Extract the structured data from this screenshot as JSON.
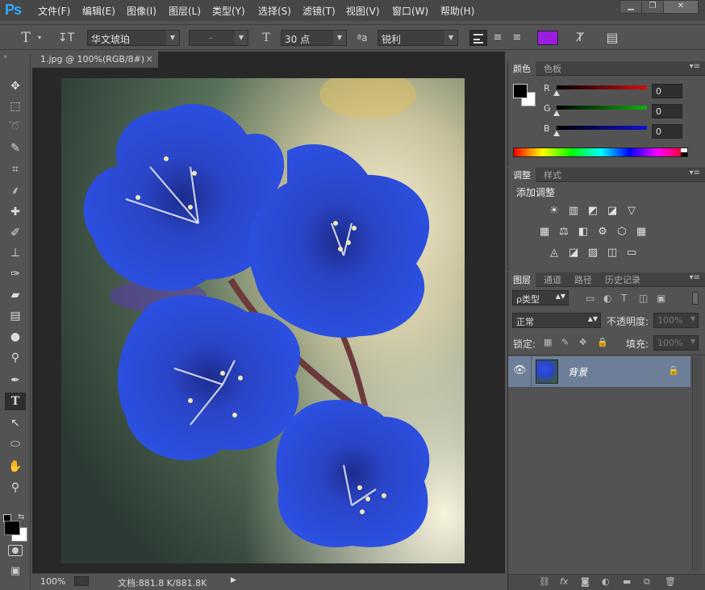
{
  "app": {
    "logo": "Ps"
  },
  "menu": [
    "文件(F)",
    "编辑(E)",
    "图像(I)",
    "图层(L)",
    "类型(Y)",
    "选择(S)",
    "滤镜(T)",
    "视图(V)",
    "窗口(W)",
    "帮助(H)"
  ],
  "window_controls": {
    "minimize": "▁",
    "restore": "❐",
    "close": "✕"
  },
  "options": {
    "tool_glyph": "T",
    "orient_glyph": "↧T",
    "font_family": "华文琥珀",
    "font_style": "-",
    "size_glyph": "T",
    "font_size": "30 点",
    "aa_glyph": "ªa",
    "antialias": "锐利",
    "text_color": "#9b1de0",
    "warp_glyph": "Ⱦ",
    "panel_glyph": "▤"
  },
  "tools": [
    {
      "name": "move-tool-icon",
      "glyph": "✥"
    },
    {
      "name": "marquee-tool-icon",
      "glyph": "⬚"
    },
    {
      "name": "lasso-tool-icon",
      "glyph": "➰"
    },
    {
      "name": "quick-select-tool-icon",
      "glyph": "✎"
    },
    {
      "name": "crop-tool-icon",
      "glyph": "⌗"
    },
    {
      "name": "eyedropper-tool-icon",
      "glyph": "⸙"
    },
    {
      "name": "healing-brush-tool-icon",
      "glyph": "✚"
    },
    {
      "name": "brush-tool-icon",
      "glyph": "✐"
    },
    {
      "name": "clone-stamp-tool-icon",
      "glyph": "⊥"
    },
    {
      "name": "history-brush-tool-icon",
      "glyph": "✑"
    },
    {
      "name": "eraser-tool-icon",
      "glyph": "▰"
    },
    {
      "name": "gradient-tool-icon",
      "glyph": "▤"
    },
    {
      "name": "blur-tool-icon",
      "glyph": "●"
    },
    {
      "name": "dodge-tool-icon",
      "glyph": "⚲"
    },
    {
      "name": "pen-tool-icon",
      "glyph": "✒"
    },
    {
      "name": "type-tool-icon",
      "glyph": "T"
    },
    {
      "name": "path-select-tool-icon",
      "glyph": "↖"
    },
    {
      "name": "ellipse-tool-icon",
      "glyph": "⬭"
    },
    {
      "name": "hand-tool-icon",
      "glyph": "✋"
    },
    {
      "name": "zoom-tool-icon",
      "glyph": "⚲"
    }
  ],
  "document": {
    "tab_title": "1.jpg @ 100%(RGB/8#)",
    "close": "×",
    "zoom": "100%",
    "doc_info": "文档:881.8 K/881.8K",
    "status_arrow": "▶"
  },
  "color_panel": {
    "tabs": [
      "颜色",
      "色板"
    ],
    "channels": [
      {
        "label": "R",
        "value": "0",
        "color": "#d01010"
      },
      {
        "label": "G",
        "value": "0",
        "color": "#10b010"
      },
      {
        "label": "B",
        "value": "0",
        "color": "#1010d0"
      }
    ]
  },
  "adjust_panel": {
    "tabs": [
      "调整",
      "样式"
    ],
    "title": "添加调整",
    "row1": [
      "☀",
      "▥",
      "◩",
      "◪",
      "▽"
    ],
    "row2": [
      "▦",
      "⚖",
      "◧",
      "⚙",
      "⬡",
      "▦"
    ],
    "row3": [
      "◬",
      "◪",
      "▨",
      "◫",
      "▭"
    ]
  },
  "layers_panel": {
    "tabs": [
      "图层",
      "通道",
      "路径",
      "历史记录"
    ],
    "filter_kind": "ρ类型",
    "filter_icons": [
      "▭",
      "◐",
      "T",
      "◫",
      "▣"
    ],
    "blend_mode": "正常",
    "opacity_label": "不透明度:",
    "opacity_value": "100%",
    "lock_label": "锁定:",
    "lock_icons": [
      "▦",
      "✎",
      "✥",
      "🔒"
    ],
    "fill_label": "填充:",
    "fill_value": "100%",
    "layers": [
      {
        "name": "背景",
        "visible_glyph": "👁",
        "lock_glyph": "🔒"
      }
    ],
    "footer_icons": [
      "⛓",
      "fx",
      "◙",
      "◐",
      "▬",
      "⧉",
      "🗑"
    ]
  },
  "panel_menu_glyph": "▾≡",
  "collapse_glyph": "»"
}
